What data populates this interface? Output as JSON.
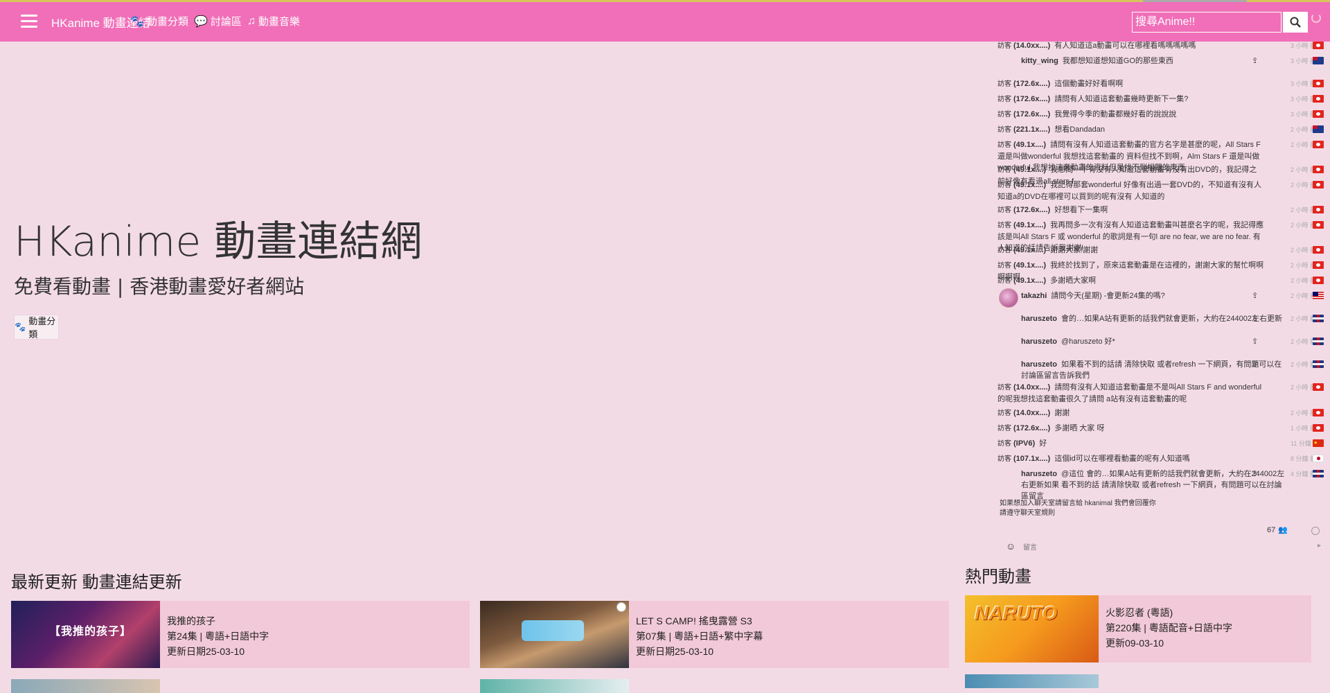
{
  "header": {
    "brand": "HKanime 動畫連結",
    "nav": [
      {
        "icon": "paw-icon",
        "glyph": "🐾",
        "label": "動畫分類"
      },
      {
        "icon": "comments-icon",
        "glyph": "💬",
        "label": "討論區"
      },
      {
        "icon": "music-icon",
        "glyph": "♫",
        "label": "動畫音樂"
      }
    ],
    "search_placeholder": "搜尋Anime!!"
  },
  "hero": {
    "title": "HKanime 動畫連結網",
    "subtitle": "免費看動畫 | 香港動畫愛好者網站",
    "button": "動畫分類"
  },
  "chat": {
    "messages": [
      {
        "ip": "(14.0xx....)",
        "text": "有人知道這a動畫可以在哪裡看嗎嗎嗎嗎嗎",
        "time": "3 小時 前",
        "flag": "hk"
      },
      {
        "user": "kitty_wing",
        "text": "我都想知道想知道GO的那些東西",
        "time": "3 小時 前",
        "flag": "au",
        "indent": true,
        "share": true
      },
      {
        "ip": "(172.6x....)",
        "text": "這個動畫好好看啊啊",
        "time": "3 小時 前",
        "flag": "hk"
      },
      {
        "ip": "(172.6x....)",
        "text": "請問有人知道這套動畫幾時更新下一集?",
        "time": "3 小時 前",
        "flag": "hk"
      },
      {
        "ip": "(172.6x....)",
        "text": "我覺得今季的動畫都幾好看的說說說",
        "time": "3 小時 前",
        "flag": "hk"
      },
      {
        "ip": "(221.1x....)",
        "text": "想看Dandadan",
        "time": "2 小時 前",
        "flag": "au"
      },
      {
        "ip": "(49.1x....)",
        "text": "請問有沒有人知道這套動畫的官方名字是甚麼的呢，All Stars F 還是叫做wonderful 我想找這套動畫的",
        "text2": "資料但找不到啊，Alm Stars F 還是叫做wonderful 我想找這套動畫的資料但是找不到相關的東西",
        "time": "2 小時 前",
        "flag": "hk"
      },
      {
        "ip": "(49.1x....)",
        "text": "我想問一下有沒有人知道這套動畫有沒有出DVD的，我記得之前好像有看過all stars f",
        "time": "2 小時 前",
        "flag": "hk"
      },
      {
        "ip": "(49.1x....)",
        "text": "我記得那套wonderful 好像有出過一套DVD的，不知道有沒有人知道a的DVD在哪裡可以買到的呢有沒有",
        "text2": "人知道的",
        "time": "2 小時 前",
        "flag": "hk"
      },
      {
        "ip": "(172.6x....)",
        "text": "好想看下一集啊",
        "time": "2 小時 前",
        "flag": "hk"
      },
      {
        "ip": "(49.1x....)",
        "text": "我再問多一次有沒有人知道這套動畫叫甚麼名字的呢，我記得應該是叫All Stars F 或 wonderful",
        "text2": "的歌詞是有一句l are no fear, we are no fear. 有人知道的話請告訴我謝謝!",
        "time": "2 小時 前",
        "flag": "hk"
      },
      {
        "ip": "(49.1x....)",
        "text": "謝謝大家!謝謝",
        "time": "2 小時 前",
        "flag": "hk"
      },
      {
        "ip": "(49.1x....)",
        "text": "我終於找到了，原來這套動畫是在這裡的，謝謝大家的幫忙啊啊啊啊啊",
        "time": "2 小時 前",
        "flag": "hk"
      },
      {
        "ip": "(49.1x....)",
        "text": "多謝晒大家啊",
        "time": "2 小時 前",
        "flag": "hk"
      },
      {
        "user": "takazhi",
        "text": "請問今天(星期) -會更新24集的嗎?",
        "time": "2 小時 前",
        "flag": "my",
        "avatar": true,
        "share": true
      },
      {
        "user": "haruszeto",
        "text": "會的…如果A站有更新的話我們就會更新，大約在244002左右更新",
        "time": "2 小時 前",
        "flag": "gb",
        "indent": true,
        "share": true
      },
      {
        "user": "haruszeto",
        "text": "@haruszeto 好*",
        "time": "2 小時 前",
        "flag": "gb",
        "indent": true,
        "share": true
      },
      {
        "user": "haruszeto",
        "text": "如果看不到的話請 清除快取 或者refresh 一下網頁，有問題可以在討論區留言告訴我們",
        "time": "2 小時 前",
        "flag": "gb",
        "indent": true,
        "share": true
      },
      {
        "ip": "(14.0xx....)",
        "text": "請問有沒有人知道這套動畫是不是叫All Stars F and wonderful 的呢我想找這套動畫很久了請問",
        "text2": "a站有沒有這套動畫的呢",
        "time": "2 小時 前",
        "flag": "hk"
      },
      {
        "ip": "(14.0xx....)",
        "text": "謝謝",
        "time": "2 小時 前",
        "flag": "hk"
      },
      {
        "ip": "(172.6x....)",
        "text": "多謝晒 大家 呀",
        "time": "1 小時 前",
        "flag": "hk"
      },
      {
        "ip": "(IPV6)",
        "text": "好",
        "time": "11 分鐘 前",
        "flag": "cn"
      },
      {
        "ip": "(107.1x....)",
        "text": "這個id可以在哪裡看動畫的呢有人知道嗎",
        "time": "8 分鐘 前",
        "flag": "jp"
      },
      {
        "user": "haruszeto",
        "text": "@這位 會的…如果A站有更新的話我們就會更新，大約在244002左右更新如果",
        "text2": "看不到的話 請清除快取 或者refresh 一下網頁，有問題可以在討論區留言",
        "time": "4 分鐘 前",
        "flag": "gb",
        "indent": true,
        "share": true
      }
    ],
    "ip_prefix": "訪客",
    "note_line1": "如果想加入聊天室請留言給 hkanimal 我們會回覆你",
    "note_line2": "請遵守聊天室規則",
    "online_count": "67",
    "input_placeholder": "留言"
  },
  "sections": {
    "latest_title": "最新更新 動畫連結更新",
    "popular_title": "熱門動畫",
    "cards": [
      {
        "title": "我推的孩子",
        "ep": "第24集 | 粵語+日語中字",
        "date": "更新日期25-03-10",
        "thumb_text": "【我推的孩子】"
      },
      {
        "title": "LET S CAMP! 搖曳露營 S3",
        "ep": "第07集 | 粵語+日語+繁中字幕",
        "date": "更新日期25-03-10"
      },
      {
        "title": "火影忍者 (粵語)",
        "ep": "第220集 | 粵語配音+日語中字",
        "date": "更新09-03-10",
        "thumb_text": "NARUTO"
      }
    ]
  }
}
